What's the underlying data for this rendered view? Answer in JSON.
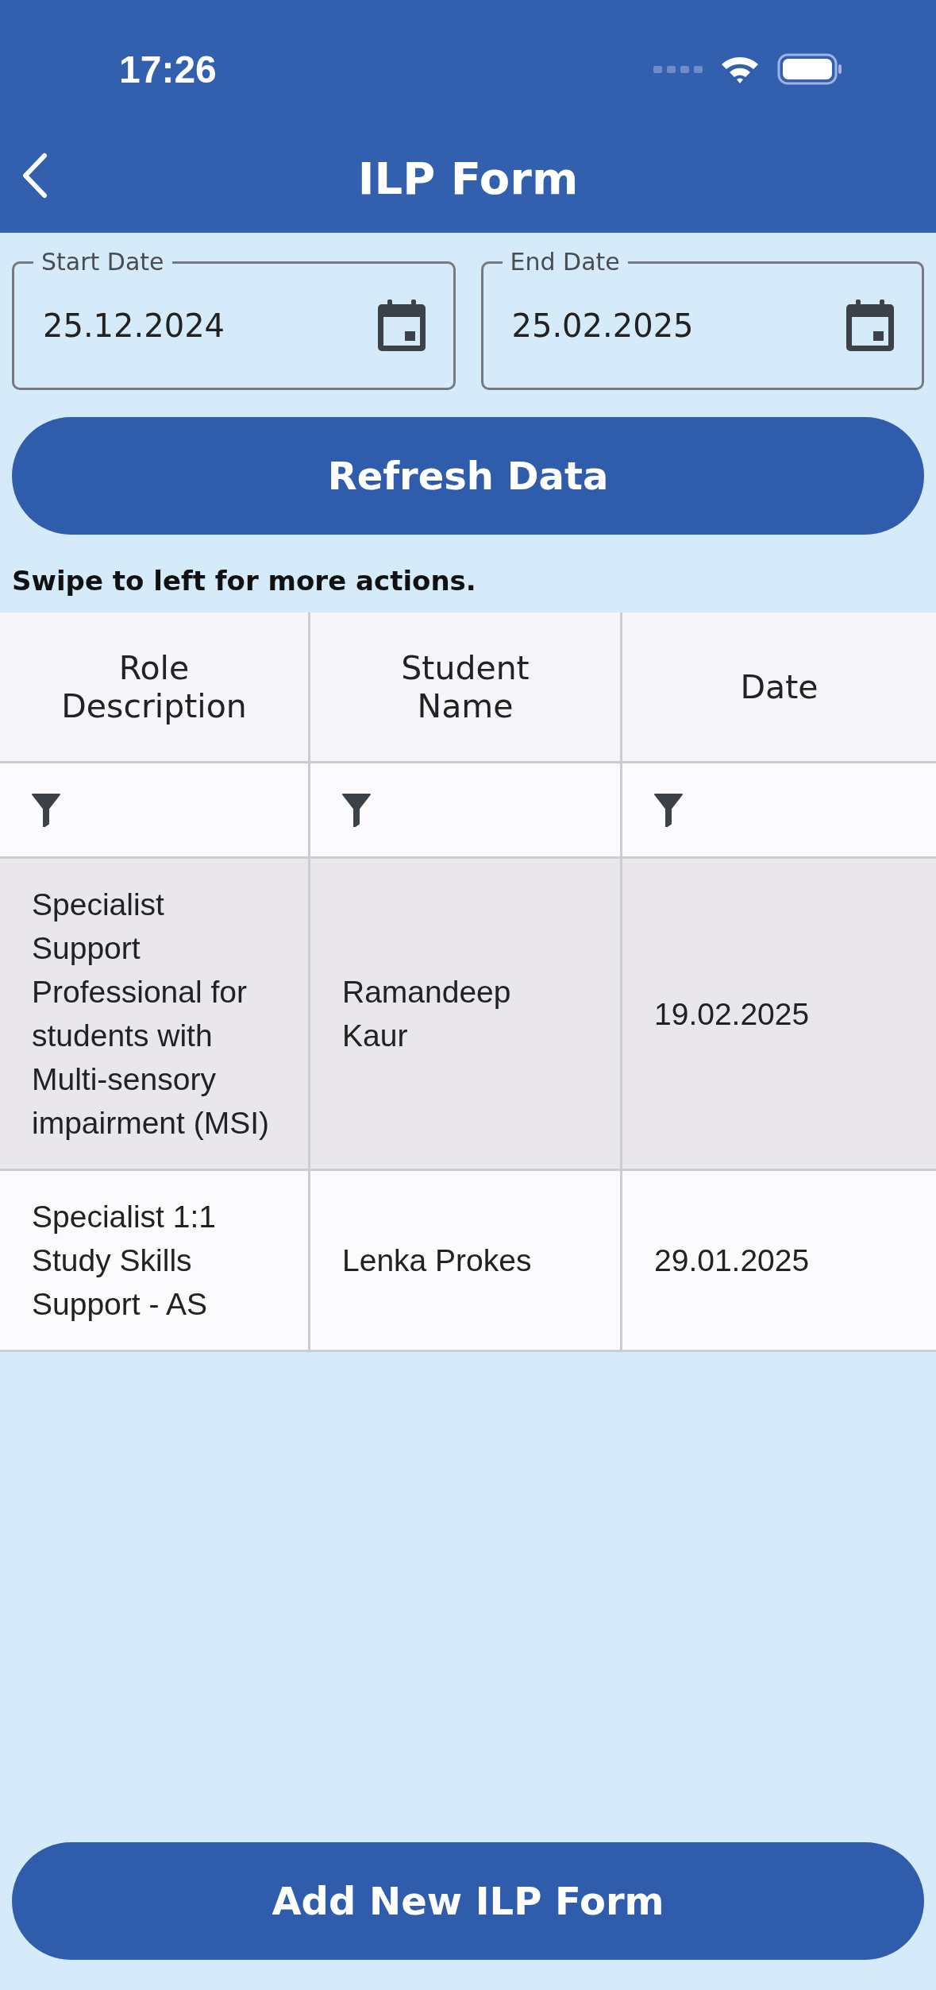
{
  "status_bar": {
    "time": "17:26"
  },
  "header": {
    "title": "ILP Form"
  },
  "date_fields": [
    {
      "label": "Start Date",
      "value": "25.12.2024"
    },
    {
      "label": "End Date",
      "value": "25.02.2025"
    }
  ],
  "refresh_button": "Refresh Data",
  "hint": "Swipe to left for more actions.",
  "table": {
    "columns": [
      "Role Description",
      "Student Name",
      "Date"
    ],
    "rows": [
      {
        "selected": true,
        "cells": [
          "Specialist Support Professional for students with Multi-sensory impairment (MSI)",
          "Ramandeep Kaur",
          "19.02.2025"
        ]
      },
      {
        "selected": false,
        "cells": [
          "Specialist 1:1 Study Skills Support - AS",
          "Lenka Prokes",
          "29.01.2025"
        ]
      }
    ]
  },
  "add_button": "Add New ILP Form"
}
